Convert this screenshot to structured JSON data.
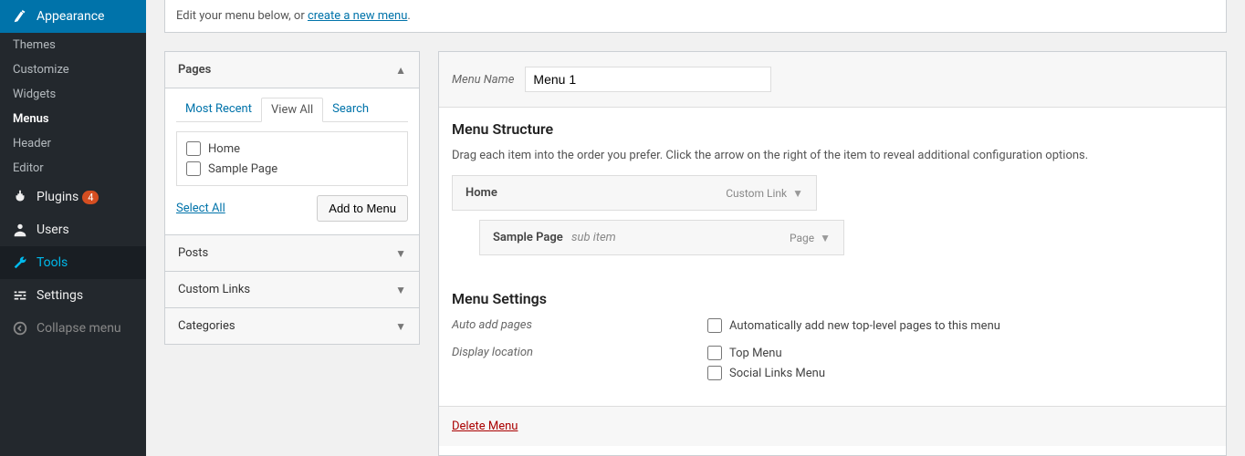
{
  "sidebar": {
    "appearance": "Appearance",
    "submenu": {
      "themes": "Themes",
      "customize": "Customize",
      "widgets": "Widgets",
      "menus": "Menus",
      "header": "Header",
      "editor": "Editor"
    },
    "plugins": "Plugins",
    "plugins_badge": "4",
    "users": "Users",
    "tools": "Tools",
    "settings": "Settings",
    "collapse": "Collapse menu"
  },
  "notice": {
    "pre": "Edit your menu below, or ",
    "link": "create a new menu",
    "post": "."
  },
  "pages_panel": {
    "title": "Pages",
    "tabs": {
      "recent": "Most Recent",
      "viewall": "View All",
      "search": "Search"
    },
    "items": {
      "home": "Home",
      "sample": "Sample Page"
    },
    "select_all": "Select All",
    "add_btn": "Add to Menu"
  },
  "closed_panels": {
    "posts": "Posts",
    "custom": "Custom Links",
    "categories": "Categories"
  },
  "menu": {
    "name_label": "Menu Name",
    "name_value": "Menu 1",
    "structure_title": "Menu Structure",
    "structure_desc": "Drag each item into the order you prefer. Click the arrow on the right of the item to reveal additional configuration options.",
    "items": [
      {
        "title": "Home",
        "type": "Custom Link",
        "sub": ""
      },
      {
        "title": "Sample Page",
        "type": "Page",
        "sub": "sub item"
      }
    ],
    "settings_title": "Menu Settings",
    "auto_add_label": "Auto add pages",
    "auto_add_opt": "Automatically add new top-level pages to this menu",
    "display_label": "Display location",
    "display_opts": {
      "top": "Top Menu",
      "social": "Social Links Menu"
    },
    "delete": "Delete Menu"
  }
}
